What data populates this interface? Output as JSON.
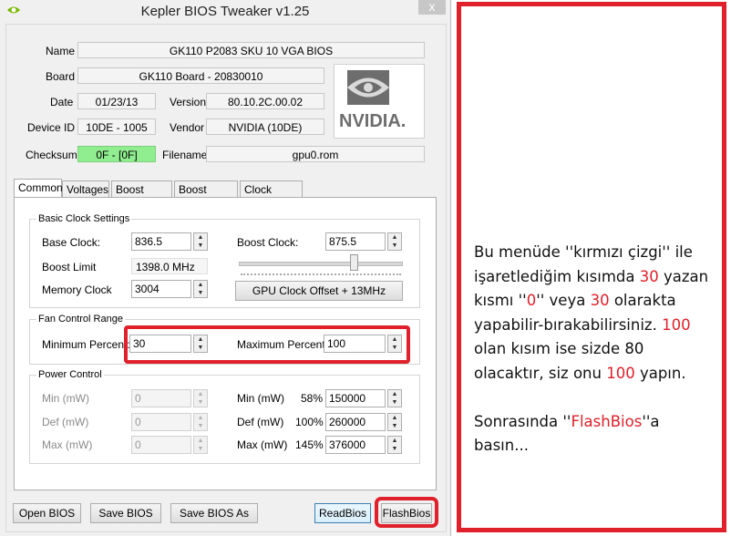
{
  "window": {
    "title": "Kepler BIOS Tweaker v1.25",
    "close": "x"
  },
  "info": {
    "name_label": "Name",
    "name_value": "GK110 P2083 SKU 10 VGA BIOS",
    "board_label": "Board",
    "board_value": "GK110 Board - 20830010",
    "date_label": "Date",
    "date_value": "01/23/13",
    "version_label": "Version",
    "version_value": "80.10.2C.00.02",
    "device_label": "Device ID",
    "device_value": "10DE - 1005",
    "vendor_label": "Vendor",
    "vendor_value": "NVIDIA (10DE)",
    "checksum_label": "Checksum",
    "checksum_value": "0F - [0F]",
    "filename_label": "Filename",
    "filename_value": "gpu0.rom",
    "logo_text": "NVIDIA.",
    "checksum_color": "#90ee90"
  },
  "tabs": [
    "Common",
    "Voltages",
    "Boost Table",
    "Boost States",
    "Clock States"
  ],
  "clock": {
    "group_title": "Basic Clock Settings",
    "base_label": "Base Clock:",
    "base_value": "836.5",
    "boost_label": "Boost Clock:",
    "boost_value": "875.5",
    "boost_limit_label": "Boost Limit",
    "boost_limit_value": "1398.0 MHz",
    "memory_label": "Memory Clock",
    "memory_value": "3004",
    "offset_button": "GPU Clock Offset + 13MHz"
  },
  "fan": {
    "group_title": "Fan Control Range",
    "min_label": "Minimum Percent:",
    "min_value": "30",
    "max_label": "Maximum Percent:",
    "max_value": "100"
  },
  "power": {
    "group_title": "Power Control",
    "left_rows": [
      {
        "label": "Min (mW)",
        "value": "0"
      },
      {
        "label": "Def (mW)",
        "value": "0"
      },
      {
        "label": "Max (mW)",
        "value": "0"
      }
    ],
    "right_rows": [
      {
        "label": "Min (mW)",
        "percent": "58%",
        "value": "150000"
      },
      {
        "label": "Def (mW)",
        "percent": "100%",
        "value": "260000"
      },
      {
        "label": "Max (mW)",
        "percent": "145%",
        "value": "376000"
      }
    ]
  },
  "buttons": {
    "open": "Open BIOS",
    "save": "Save BIOS",
    "save_as": "Save BIOS As",
    "read": "ReadBios",
    "flash": "FlashBios"
  },
  "annotation": {
    "line1a": "Bu menüde ''kırmızı çizgi'' ile işaretlediğim kısımda ",
    "line1b": "30",
    "line1c": " yazan kısmı ''",
    "line1d": "0",
    "line1e": "'' veya ",
    "line1f": "30",
    "line1g": " olarakta yapabilir-bırakabilirsiniz. ",
    "line1h": "100",
    "line1i": " olan kısım ise sizde 80 olacaktır, siz onu ",
    "line1j": "100",
    "line1k": " yapın.",
    "line2a": "Sonrasında ''",
    "line2b": "FlashBios",
    "line2c": "''a basın...",
    "accent_color": "#e0202a"
  }
}
